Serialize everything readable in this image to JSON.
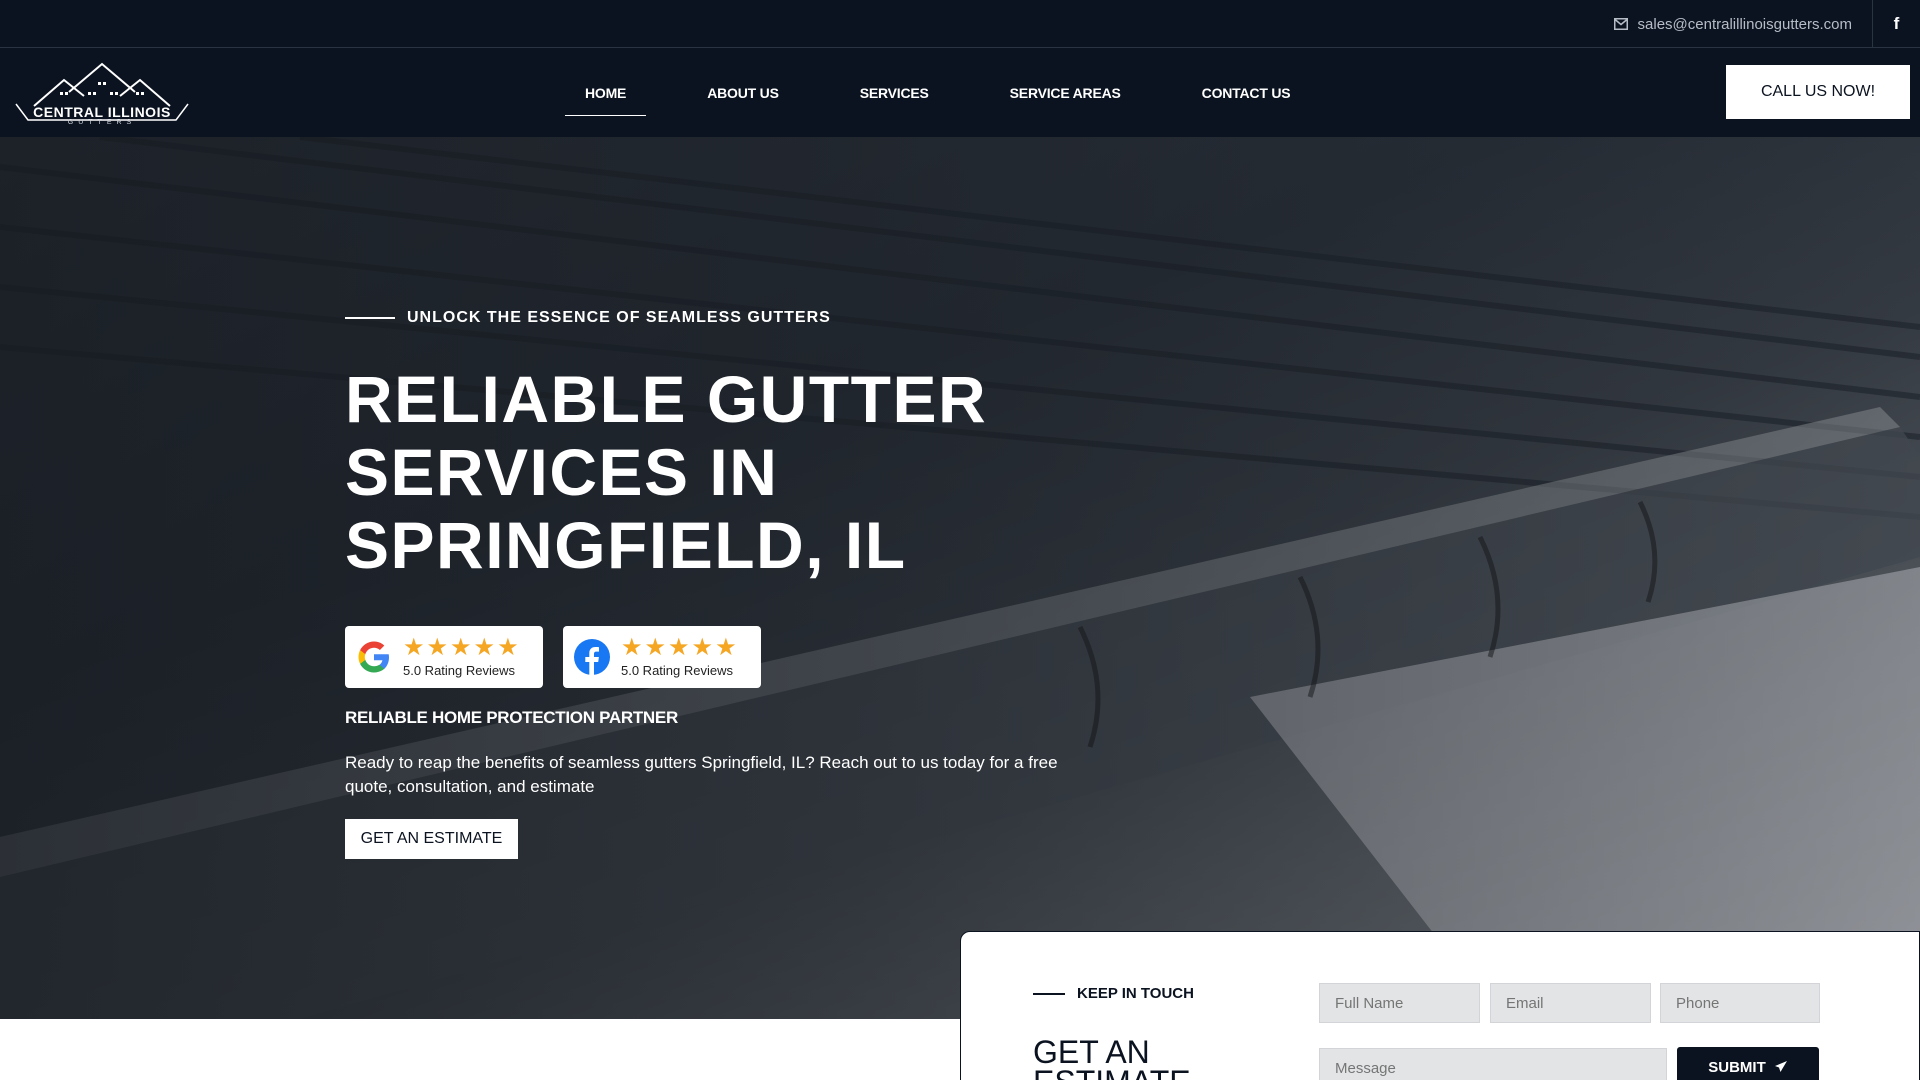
{
  "topbar": {
    "email": "sales@centralillinoisgutters.com",
    "email_icon": "envelope-icon",
    "social_icon": "facebook-icon",
    "social_label": "f"
  },
  "nav": {
    "logo_text": "CENTRAL ILLINOIS",
    "logo_sub": "GUTTERS",
    "items": [
      {
        "label": "HOME",
        "active": true
      },
      {
        "label": "ABOUT US"
      },
      {
        "label": "SERVICES"
      },
      {
        "label": "SERVICE AREAS"
      },
      {
        "label": "CONTACT US"
      }
    ],
    "cta_label": "CALL US NOW!"
  },
  "hero": {
    "eyebrow": "UNLOCK THE ESSENCE OF SEAMLESS GUTTERS",
    "headline_lines": [
      "RELIABLE GUTTER",
      "SERVICES IN",
      "SPRINGFIELD, IL"
    ],
    "badges": [
      {
        "platform_icon": "google-icon",
        "stars": "★★★★★",
        "rating_text": "5.0 Rating Reviews"
      },
      {
        "platform_icon": "facebook-icon",
        "stars": "★★★★★",
        "rating_text": "5.0 Rating Reviews"
      }
    ],
    "subhead": "RELIABLE HOME PROTECTION PARTNER",
    "description": "Ready to reap the benefits of seamless gutters Springfield, IL? Reach out to us today for a free quote, consultation, and estimate",
    "button_label": "GET AN ESTIMATE"
  },
  "form": {
    "eyebrow": "KEEP IN TOUCH",
    "title": "GET AN ESTIMATE",
    "placeholders": {
      "full_name": "Full Name",
      "email": "Email",
      "phone": "Phone",
      "message": "Message"
    },
    "submit_label": "SUBMIT",
    "submit_icon": "paper-plane-icon"
  },
  "colors": {
    "header_bg": "#0b1320",
    "star": "#f5a623",
    "white": "#ffffff"
  }
}
